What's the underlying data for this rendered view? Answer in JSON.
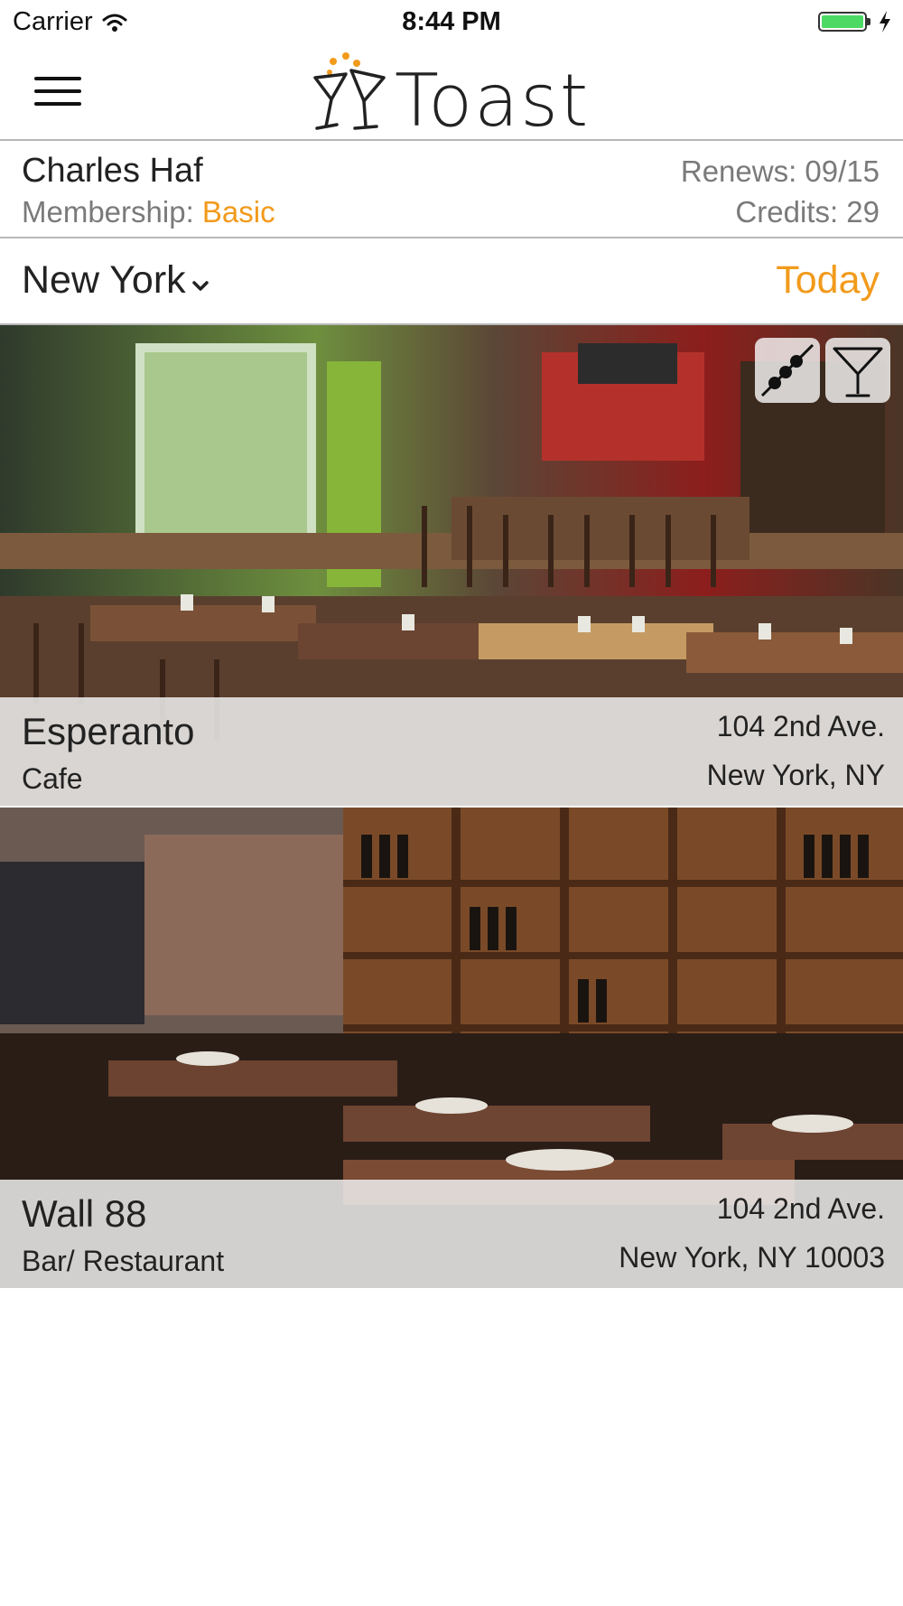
{
  "status_bar": {
    "carrier": "Carrier",
    "time": "8:44 PM"
  },
  "header": {
    "app_name": "Toast"
  },
  "member": {
    "name": "Charles Haf",
    "membership_label": "Membership:",
    "membership_value": "Basic",
    "renews": "Renews: 09/15",
    "credits": "Credits: 29"
  },
  "filter": {
    "city": "New York",
    "date": "Today"
  },
  "venues": [
    {
      "name": "Esperanto",
      "type": "Cafe",
      "address_line1": "104 2nd Ave.",
      "address_line2": "New York, NY",
      "badges": [
        "skewer-icon",
        "martini-icon"
      ]
    },
    {
      "name": "Wall 88",
      "type": "Bar/ Restaurant",
      "address_line1": "104 2nd Ave.",
      "address_line2": "New York, NY 10003",
      "badges": []
    }
  ],
  "colors": {
    "accent": "#f29a1b",
    "battery": "#4cd964",
    "divider": "#b8b8b8"
  }
}
